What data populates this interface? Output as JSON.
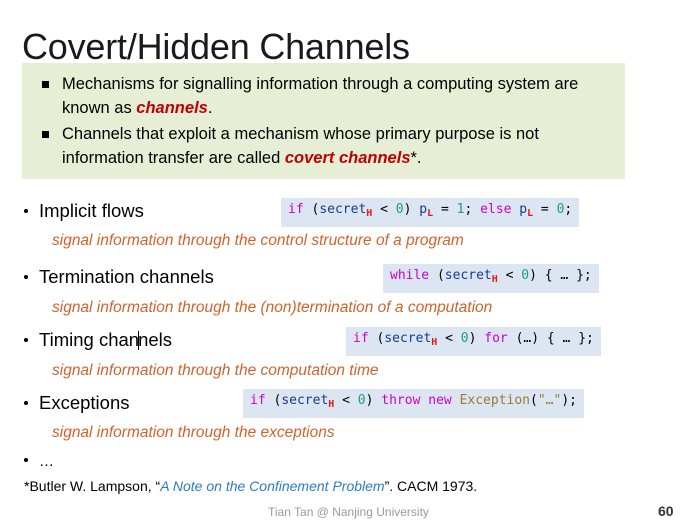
{
  "slide": {
    "title": "Covert/Hidden Channels",
    "colors": {
      "callout_bg": "#e7eed6",
      "code_bg": "#dce6f2",
      "accent_red": "#c00000",
      "accent_orange": "#d2622b",
      "link_blue": "#2b7cc4"
    }
  },
  "callout": {
    "items": [
      {
        "text_before": "Mechanisms for signalling information through a computing system are known as ",
        "emphasis": "channels",
        "text_after": "."
      },
      {
        "text_before": "Channels that exploit a mechanism whose primary purpose is not information transfer are called ",
        "emphasis": "covert channels",
        "text_after": "*."
      }
    ]
  },
  "bullets": [
    {
      "label": "Implicit flows",
      "subtitle": "signal information through the control structure of a program",
      "code": {
        "tokens": [
          {
            "t": "if",
            "c": "kw"
          },
          {
            "t": " (",
            "c": "pln"
          },
          {
            "t": "secret",
            "c": "var"
          },
          {
            "t": "H",
            "c": "sub"
          },
          {
            "t": " < ",
            "c": "pln"
          },
          {
            "t": "0",
            "c": "num"
          },
          {
            "t": ") ",
            "c": "pln"
          },
          {
            "t": "p",
            "c": "var"
          },
          {
            "t": "L",
            "c": "sub"
          },
          {
            "t": " = ",
            "c": "pln"
          },
          {
            "t": "1",
            "c": "num"
          },
          {
            "t": "; ",
            "c": "pln"
          },
          {
            "t": "else",
            "c": "kw"
          },
          {
            "t": " ",
            "c": "pln"
          },
          {
            "t": "p",
            "c": "var"
          },
          {
            "t": "L",
            "c": "sub"
          },
          {
            "t": " = ",
            "c": "pln"
          },
          {
            "t": "0",
            "c": "num"
          },
          {
            "t": ";",
            "c": "pln"
          }
        ]
      }
    },
    {
      "label": "Termination channels",
      "subtitle": "signal information through the (non)termination of a computation",
      "code": {
        "tokens": [
          {
            "t": "while",
            "c": "kw"
          },
          {
            "t": " (",
            "c": "pln"
          },
          {
            "t": "secret",
            "c": "var"
          },
          {
            "t": "H",
            "c": "sub"
          },
          {
            "t": " < ",
            "c": "pln"
          },
          {
            "t": "0",
            "c": "num"
          },
          {
            "t": ") { … };",
            "c": "pln"
          }
        ]
      }
    },
    {
      "label": "Timing channels",
      "label_caret_after": "Timing chan",
      "subtitle": "signal information through the computation time",
      "code": {
        "tokens": [
          {
            "t": "if",
            "c": "kw"
          },
          {
            "t": " (",
            "c": "pln"
          },
          {
            "t": "secret",
            "c": "var"
          },
          {
            "t": "H",
            "c": "sub"
          },
          {
            "t": " < ",
            "c": "pln"
          },
          {
            "t": "0",
            "c": "num"
          },
          {
            "t": ") ",
            "c": "pln"
          },
          {
            "t": "for",
            "c": "kw"
          },
          {
            "t": " (…) { … };",
            "c": "pln"
          }
        ]
      }
    },
    {
      "label": "Exceptions",
      "subtitle": "signal information through the exceptions",
      "code": {
        "tokens": [
          {
            "t": "if",
            "c": "kw"
          },
          {
            "t": " (",
            "c": "pln"
          },
          {
            "t": "secret",
            "c": "var"
          },
          {
            "t": "H",
            "c": "sub"
          },
          {
            "t": " < ",
            "c": "pln"
          },
          {
            "t": "0",
            "c": "num"
          },
          {
            "t": ") ",
            "c": "pln"
          },
          {
            "t": "throw",
            "c": "kw"
          },
          {
            "t": " ",
            "c": "pln"
          },
          {
            "t": "new",
            "c": "kw"
          },
          {
            "t": " ",
            "c": "pln"
          },
          {
            "t": "Exception",
            "c": "cls"
          },
          {
            "t": "(",
            "c": "pln"
          },
          {
            "t": "\"…\"",
            "c": "str"
          },
          {
            "t": ");",
            "c": "pln"
          }
        ]
      }
    },
    {
      "label": "…",
      "subtitle": "",
      "code": null
    }
  ],
  "footnote": {
    "marker": "*",
    "author": "Butler W. Lampson, ",
    "quote_open": "“",
    "paper_title": "A Note on the Confinement Problem",
    "quote_close": "”",
    "venue": ". CACM 1973."
  },
  "footer": {
    "credit": "Tian Tan @ Nanjing University",
    "page": "60"
  }
}
